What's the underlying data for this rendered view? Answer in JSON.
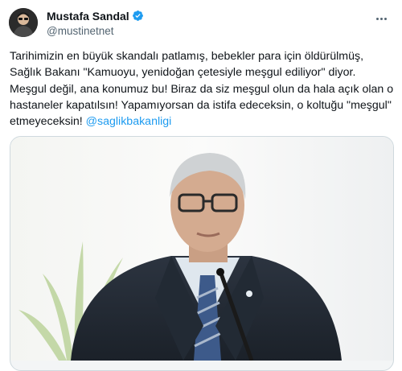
{
  "author": {
    "display_name": "Mustafa Sandal",
    "handle": "@mustinetnet",
    "verified": true
  },
  "tweet": {
    "text_lines": [
      "Tarihimizin en büyük skandalı patlamış, bebekler para için öldürülmüş,",
      "Sağlık Bakanı \"Kamuoyu, yenidoğan çetesiyle meşgul ediliyor\" diyor.",
      "Meşgul değil, ana konumuz bu! Biraz da siz meşgul olun da hala açık olan o",
      "hastaneler kapatılsın! Yapamıyorsan da istifa edeceksin, o koltuğu \"meşgul\"",
      "etmeyeceksin! "
    ],
    "mention": "@saglikbakanligi"
  },
  "media": {
    "subject": "photo-of-man-in-suit-at-microphone"
  },
  "colors": {
    "accent": "#1d9bf0",
    "text": "#0f1419",
    "secondary_text": "#536471",
    "border": "#cfd9de"
  },
  "icons": {
    "verified": "verified-badge-icon",
    "more": "more-options-icon"
  }
}
